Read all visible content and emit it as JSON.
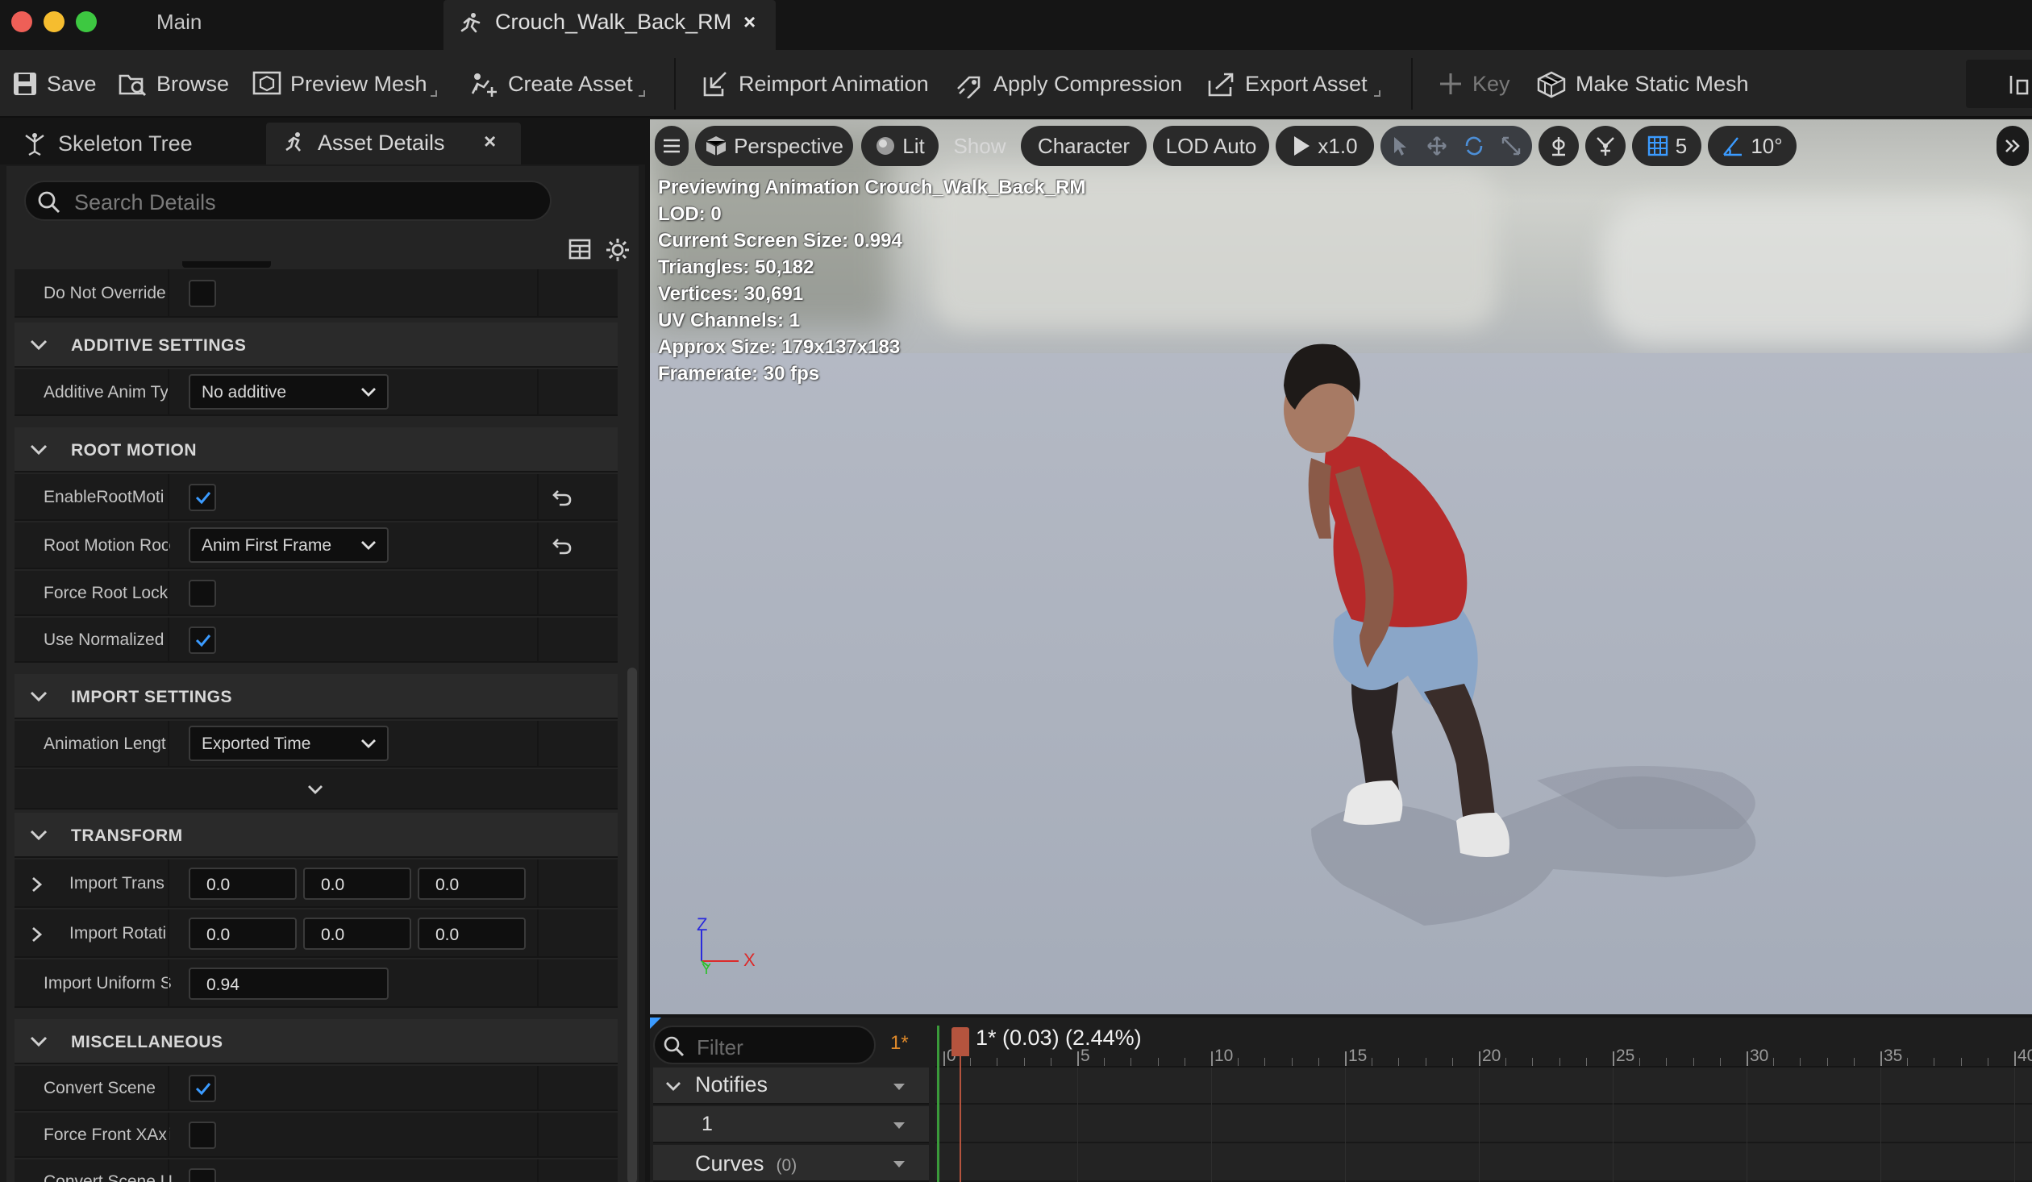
{
  "titlebar": {
    "main_tab": "Main",
    "doc_tab": "Crouch_Walk_Back_RM",
    "close": "×"
  },
  "toolbar": {
    "save": "Save",
    "browse": "Browse",
    "preview_mesh": "Preview Mesh",
    "create_asset": "Create Asset",
    "reimport": "Reimport Animation",
    "apply_compression": "Apply Compression",
    "export_asset": "Export Asset",
    "key": "Key",
    "make_static_mesh": "Make Static Mesh"
  },
  "left_panel": {
    "tab_skeleton": "Skeleton Tree",
    "tab_details": "Asset Details",
    "close": "×",
    "search_placeholder": "Search Details",
    "do_not_override": "Do Not Override",
    "sections": {
      "additive": "ADDITIVE SETTINGS",
      "root_motion": "ROOT MOTION",
      "import": "IMPORT SETTINGS",
      "transform": "TRANSFORM",
      "misc": "MISCELLANEOUS"
    },
    "additive_anim_type_label": "Additive Anim Ty",
    "additive_anim_type_value": "No additive",
    "enable_root_motion_label": "EnableRootMoti",
    "enable_root_motion_checked": true,
    "root_motion_root_label": "Root Motion Roo",
    "root_motion_root_value": "Anim First Frame",
    "force_root_lock_label": "Force Root Lock",
    "force_root_lock_checked": false,
    "use_normalized_label": "Use Normalized",
    "use_normalized_checked": true,
    "animation_length_label": "Animation Lengt",
    "animation_length_value": "Exported Time",
    "import_translation_label": "Import Trans",
    "import_translation": [
      "0.0",
      "0.0",
      "0.0"
    ],
    "import_rotation_label": "Import Rotati",
    "import_rotation": [
      "0.0",
      "0.0",
      "0.0"
    ],
    "import_uniform_scale_label": "Import Uniform S",
    "import_uniform_scale": "0.94",
    "convert_scene_label": "Convert Scene",
    "convert_scene_checked": true,
    "force_front_x_label": "Force Front XAxi",
    "force_front_x_checked": false,
    "convert_scene_u_label": "Convert Scene U"
  },
  "viewport": {
    "perspective": "Perspective",
    "lit": "Lit",
    "show": "Show",
    "character": "Character",
    "lod": "LOD Auto",
    "play_rate": "x1.0",
    "grid_snap": "5",
    "angle_snap": "10°",
    "stats": [
      "Previewing Animation Crouch_Walk_Back_RM",
      "LOD: 0",
      "Current Screen Size: 0.994",
      "Triangles: 50,182",
      "Vertices: 30,691",
      "UV Channels: 1",
      "Approx Size: 179x137x183",
      "Framerate: 30 fps"
    ],
    "axis_z": "Z",
    "axis_x": "X",
    "axis_y": "Y"
  },
  "timeline": {
    "filter_placeholder": "Filter",
    "star": "1*",
    "notifies": "Notifies",
    "notify_track": "1",
    "curves": "Curves",
    "curves_count": "(0)",
    "frame_info": "1* (0.03) (2.44%)",
    "ticks": [
      "0",
      "5",
      "10",
      "15",
      "20",
      "25",
      "30",
      "35",
      "40"
    ]
  }
}
